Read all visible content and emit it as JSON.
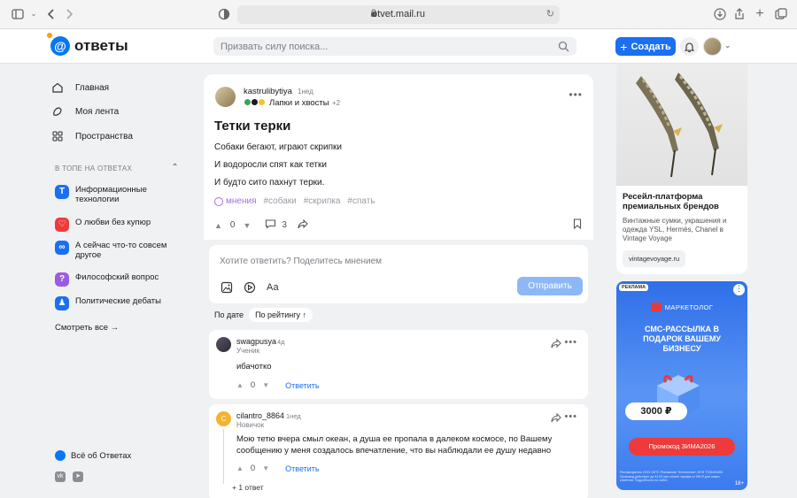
{
  "browser": {
    "url": "otvet.mail.ru"
  },
  "header": {
    "logo_text": "ответы",
    "search_placeholder": "Призвать силу поиска...",
    "create_label": "Создать"
  },
  "sidebar": {
    "nav": [
      {
        "label": "Главная",
        "icon": "home-icon"
      },
      {
        "label": "Моя лента",
        "icon": "feed-icon"
      },
      {
        "label": "Пространства",
        "icon": "spaces-icon"
      }
    ],
    "top_heading": "В ТОПЕ НА ОТВЕТАХ",
    "topics": [
      {
        "label": "Информационные технологии",
        "color": "#1a6ff2",
        "glyph": "IT"
      },
      {
        "label": "О любви без купюр",
        "color": "#ee3a3a",
        "glyph": "♡"
      },
      {
        "label": "А сейчас что-то совсем другое",
        "color": "#1a6ff2",
        "glyph": "∞"
      },
      {
        "label": "Философский вопрос",
        "color": "#9b5ce0",
        "glyph": "?"
      },
      {
        "label": "Политические дебаты",
        "color": "#1a6ff2",
        "glyph": "♟"
      }
    ],
    "see_all": "Смотреть все →",
    "about": "Всё об Ответах",
    "socials": [
      "vk",
      "telegram"
    ]
  },
  "question": {
    "user": "kastrulibytiya",
    "time": "1нед",
    "topic": "Лапки и хвосты",
    "topic_more": "+2",
    "title": "Тетки терки",
    "lines": [
      "Собаки бегают, играют скрипки",
      "И водоросли спят как тетки",
      "И будто сито пахнут терки."
    ],
    "opinions_tag": "мнения",
    "tags": [
      "#собаки",
      "#скрипка",
      "#спать"
    ],
    "votes": "0",
    "comments": "3"
  },
  "answer_box": {
    "placeholder": "Хотите ответить? Поделитесь мнением",
    "format_label": "Аа",
    "send_label": "Отправить"
  },
  "sort": {
    "by_date": "По дате",
    "by_rating": "По рейтингу"
  },
  "comments": [
    {
      "user": "swagpusya",
      "time": "4д",
      "role": "Ученик",
      "text": "ибачотко",
      "votes": "0",
      "reply_label": "Ответить",
      "avatar_letter": ""
    },
    {
      "user": "cilantro_8864",
      "time": "1нед",
      "role": "Новичок",
      "text": "Мою тетю вчера смыл океан, а душа ее пропала в далеком космосе, по Вашему сообщению у меня создалось впечатление, что вы наблюдали ее душу недавно",
      "votes": "0",
      "reply_label": "Ответить",
      "avatar_letter": "C",
      "more_replies": "1 ответ"
    }
  ],
  "ads": {
    "ad1": {
      "title": "Ресейл-платформа премиальных брендов",
      "desc": "Винтажные сумки, украшения и одежда YSL, Hermès, Chanel в Vintage Voyage",
      "link": "vintagevoyage.ru"
    },
    "ad2": {
      "badge": "РЕКЛАМА",
      "brand": "МАРКЕТОЛОГ",
      "headline": "СМС-РАССЫЛКА В ПОДАРОК ВАШЕМУ БИЗНЕСУ",
      "price": "3000 ₽",
      "promo": "Промокод ЗИМА2026",
      "legal": "Рекламодатель ООО «МТС Рекламные Технологии», ИНН 7728401695. Промокод действует до 31.03 при оплате тарифа от 990 ₽ для новых клиентов. Подробности на сайте.",
      "age": "18+"
    }
  }
}
